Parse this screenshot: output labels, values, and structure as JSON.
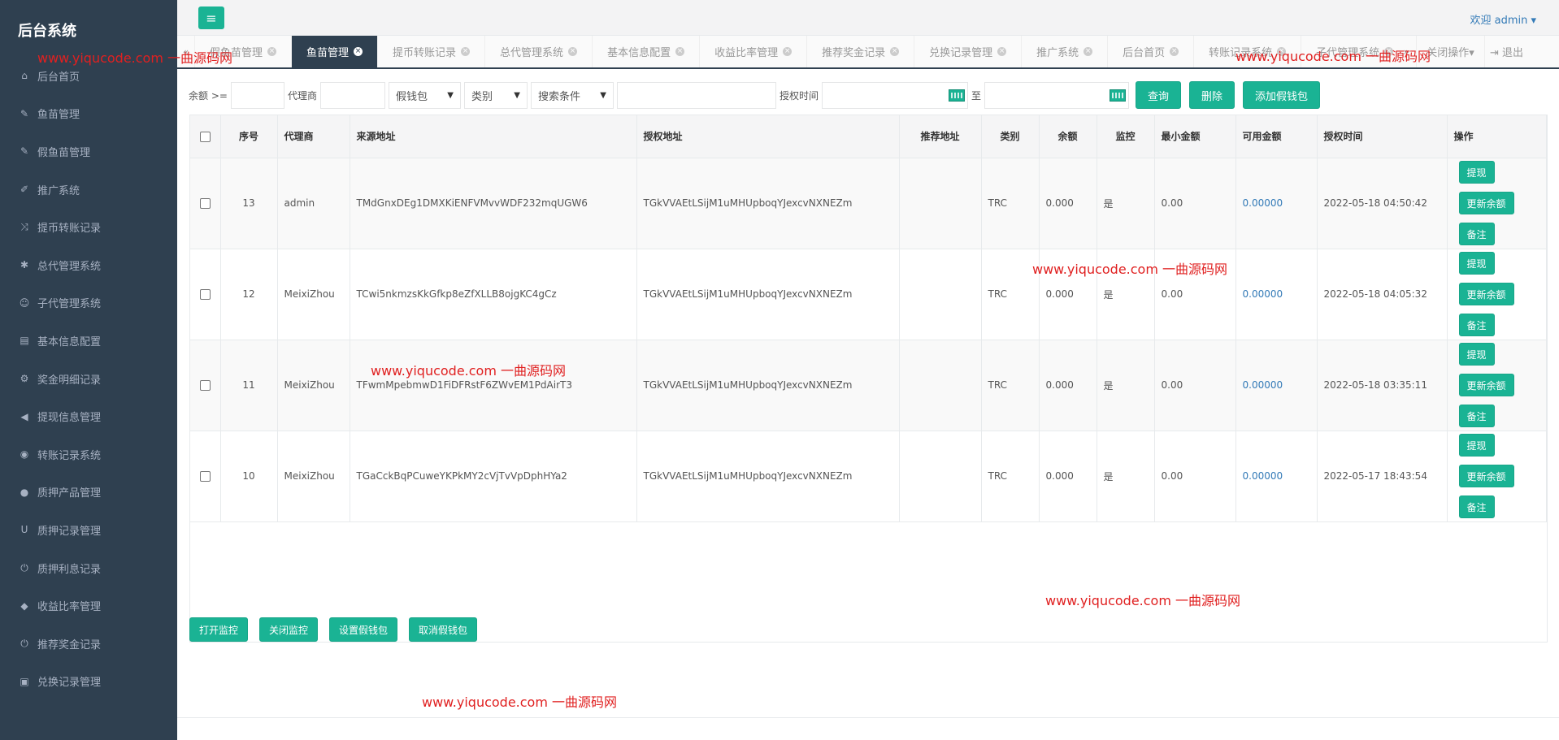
{
  "sidebar": {
    "brand": "后台系统",
    "items": [
      {
        "label": "后台首页",
        "icon": "home-icon",
        "glyph": "⌂"
      },
      {
        "label": "鱼苗管理",
        "icon": "wrench-icon",
        "glyph": "✎"
      },
      {
        "label": "假鱼苗管理",
        "icon": "wrench-icon",
        "glyph": "✎"
      },
      {
        "label": "推广系统",
        "icon": "edit-icon",
        "glyph": "✐"
      },
      {
        "label": "提币转账记录",
        "icon": "shuffle-icon",
        "glyph": "⤨"
      },
      {
        "label": "总代管理系统",
        "icon": "asterisk-icon",
        "glyph": "✱"
      },
      {
        "label": "子代管理系统",
        "icon": "users-icon",
        "glyph": "☺"
      },
      {
        "label": "基本信息配置",
        "icon": "file-icon",
        "glyph": "▤"
      },
      {
        "label": "奖金明细记录",
        "icon": "cogs-icon",
        "glyph": "⚙"
      },
      {
        "label": "提现信息管理",
        "icon": "bullhorn-icon",
        "glyph": "◀"
      },
      {
        "label": "转账记录系统",
        "icon": "dashboard-icon",
        "glyph": "◉"
      },
      {
        "label": "质押产品管理",
        "icon": "comment-icon",
        "glyph": "●"
      },
      {
        "label": "质押记录管理",
        "icon": "magnet-icon",
        "glyph": "U"
      },
      {
        "label": "质押利息记录",
        "icon": "power-icon",
        "glyph": "⏻"
      },
      {
        "label": "收益比率管理",
        "icon": "shield-icon",
        "glyph": "◆"
      },
      {
        "label": "推荐奖金记录",
        "icon": "power-icon",
        "glyph": "⏻"
      },
      {
        "label": "兑换记录管理",
        "icon": "save-icon",
        "glyph": "▣"
      }
    ]
  },
  "topbar": {
    "menu_glyph": "≡",
    "welcome": "欢迎 admin ▾"
  },
  "tabs": {
    "back_glyph": "«",
    "items": [
      {
        "label": "假鱼苗管理",
        "active": false
      },
      {
        "label": "鱼苗管理",
        "active": true
      },
      {
        "label": "提币转账记录",
        "active": false
      },
      {
        "label": "总代管理系统",
        "active": false
      },
      {
        "label": "基本信息配置",
        "active": false
      },
      {
        "label": "收益比率管理",
        "active": false
      },
      {
        "label": "推荐奖金记录",
        "active": false
      },
      {
        "label": "兑换记录管理",
        "active": false
      },
      {
        "label": "推广系统",
        "active": false
      },
      {
        "label": "后台首页",
        "active": false
      },
      {
        "label": "转账记录系统",
        "active": false
      },
      {
        "label": "子代管理系统",
        "active": false
      }
    ],
    "forward_glyph": "»",
    "close_ops": "关闭操作▾",
    "logout": "⇥ 退出"
  },
  "filter": {
    "balance_label": "余额 >=",
    "agent_label": "代理商",
    "wallet_select": "假钱包",
    "type_select": "类别",
    "search_select": "搜索条件",
    "auth_time_label": "授权时间",
    "to_label": "至",
    "query_btn": "查询",
    "delete_btn": "删除",
    "add_btn": "添加假钱包"
  },
  "table": {
    "headers": [
      "序号",
      "代理商",
      "来源地址",
      "授权地址",
      "推荐地址",
      "类别",
      "余额",
      "监控",
      "最小金额",
      "可用金额",
      "授权时间",
      "操作"
    ],
    "rows": [
      {
        "id": "13",
        "agent": "admin",
        "source": "TMdGnxDEg1DMXKiENFVMvvWDF232mqUGW6",
        "auth": "TGkVVAEtLSijM1uMHUpboqYJexcvNXNEZm",
        "ref": "",
        "type": "TRC",
        "balance": "0.000",
        "monitor": "是",
        "min": "0.00",
        "avail": "0.00000",
        "time": "2022-05-18 04:50:42"
      },
      {
        "id": "12",
        "agent": "MeixiZhou",
        "source": "TCwi5nkmzsKkGfkp8eZfXLLB8ojgKC4gCz",
        "auth": "TGkVVAEtLSijM1uMHUpboqYJexcvNXNEZm",
        "ref": "",
        "type": "TRC",
        "balance": "0.000",
        "monitor": "是",
        "min": "0.00",
        "avail": "0.00000",
        "time": "2022-05-18 04:05:32"
      },
      {
        "id": "11",
        "agent": "MeixiZhou",
        "source": "TFwmMpebmwD1FiDFRstF6ZWvEM1PdAirT3",
        "auth": "TGkVVAEtLSijM1uMHUpboqYJexcvNXNEZm",
        "ref": "",
        "type": "TRC",
        "balance": "0.000",
        "monitor": "是",
        "min": "0.00",
        "avail": "0.00000",
        "time": "2022-05-18 03:35:11"
      },
      {
        "id": "10",
        "agent": "MeixiZhou",
        "source": "TGaCckBqPCuweYKPkMY2cVjTvVpDphHYa2",
        "auth": "TGkVVAEtLSijM1uMHUpboqYJexcvNXNEZm",
        "ref": "",
        "type": "TRC",
        "balance": "0.000",
        "monitor": "是",
        "min": "0.00",
        "avail": "0.00000",
        "time": "2022-05-17 18:43:54"
      }
    ],
    "ops": [
      "提现",
      "更新余额",
      "备注"
    ]
  },
  "bottom_buttons": [
    "打开监控",
    "关闭监控",
    "设置假钱包",
    "取消假钱包"
  ],
  "watermark": "www.yiqucode.com  一曲源码网"
}
